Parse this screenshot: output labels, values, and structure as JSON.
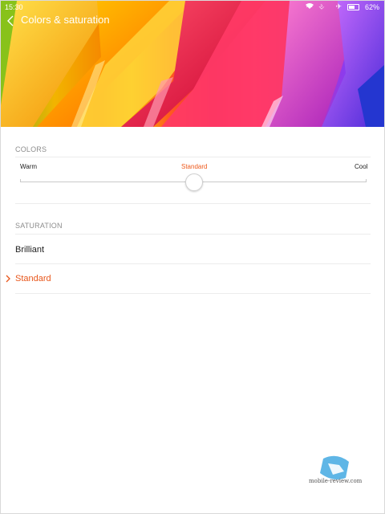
{
  "status_bar": {
    "time": "15:30",
    "battery": "62%",
    "icons": [
      "more-dots-icon",
      "alarm-off-icon",
      "wifi-icon",
      "airplane-icon",
      "battery-icon"
    ]
  },
  "header": {
    "title": "Colors & saturation",
    "back_icon": "chevron-left-icon"
  },
  "colors": {
    "section_label": "COLORS",
    "slider": {
      "left_label": "Warm",
      "center_label": "Standard",
      "right_label": "Cool",
      "value_fraction": 0.5
    }
  },
  "saturation": {
    "section_label": "SATURATION",
    "options": [
      {
        "label": "Brilliant",
        "selected": false
      },
      {
        "label": "Standard",
        "selected": true
      }
    ]
  },
  "watermark": {
    "text": "mobile-review.com"
  },
  "colors_palette": {
    "accent": "#e8561b",
    "section_text": "#8d8d8d",
    "divider": "#ececec"
  }
}
